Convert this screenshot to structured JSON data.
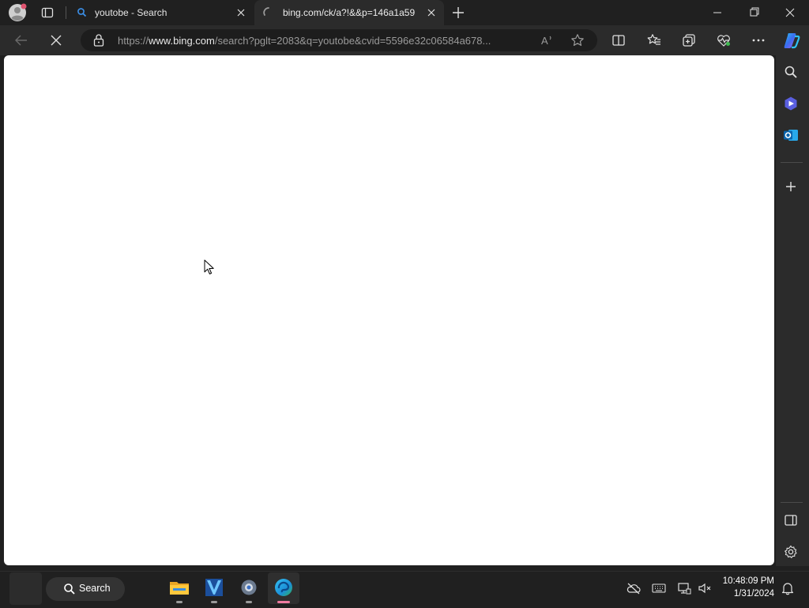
{
  "browser": {
    "tabs": [
      {
        "title": "youtobe - Search",
        "active": false,
        "icon": "search-icon"
      },
      {
        "title": "bing.com/ck/a?!&&p=146a1a59",
        "active": true,
        "icon": "loading-spinner-icon"
      }
    ],
    "address": {
      "scheme": "https://",
      "host": "www.bing.com",
      "path": "/search?pglt=2083&q=youtobe&cvid=5596e32c06584a678..."
    },
    "read_aloud_label": "A",
    "status": "loading"
  },
  "taskbar": {
    "search_label": "Search",
    "time": "10:48:09 PM",
    "date": "1/31/2024",
    "pinned_apps": [
      "file-explorer-icon",
      "app-icon",
      "settings-icon",
      "edge-icon"
    ]
  },
  "colors": {
    "chrome_bg": "#202020",
    "toolbar_bg": "#2b2b2b",
    "accent": "#0078d4",
    "page_bg": "#ffffff"
  }
}
